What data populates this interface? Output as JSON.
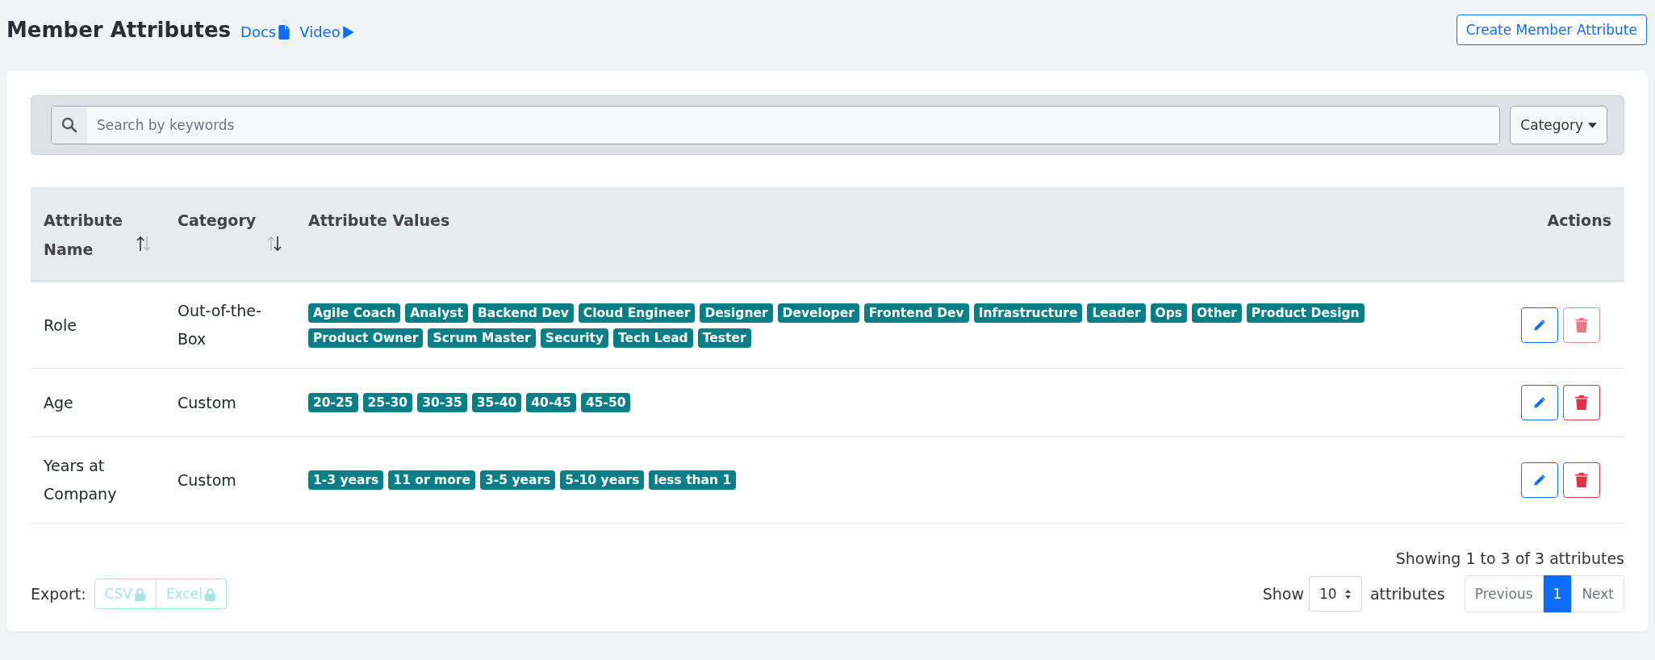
{
  "header": {
    "title": "Member Attributes",
    "links": [
      {
        "label": "Docs",
        "kind": "doc"
      },
      {
        "label": "Video",
        "kind": "video"
      }
    ],
    "create_button": "Create Member Attribute"
  },
  "filter": {
    "search": {
      "placeholder": "Search by keywords"
    },
    "category_dropdown": "Category"
  },
  "table": {
    "columns": [
      {
        "label": "Attribute Name",
        "sortable": true,
        "ascending": true
      },
      {
        "label": "Category",
        "sortable": true,
        "ascending": false
      },
      {
        "label": "Attribute Values",
        "sortable": false
      },
      {
        "label": "Actions",
        "sortable": false
      }
    ],
    "rows": [
      {
        "name": "Role",
        "category": "Out-of-the-Box",
        "values": [
          "Agile Coach",
          "Analyst",
          "Backend Dev",
          "Cloud Engineer",
          "Designer",
          "Developer",
          "Frontend Dev",
          "Infrastructure",
          "Leader",
          "Ops",
          "Other",
          "Product Design",
          "Product Owner",
          "Scrum Master",
          "Security",
          "Tech Lead",
          "Tester"
        ],
        "delete_disabled": true
      },
      {
        "name": "Age",
        "category": "Custom",
        "values": [
          "20-25",
          "25-30",
          "30-35",
          "35-40",
          "40-45",
          "45-50"
        ],
        "delete_disabled": false
      },
      {
        "name": "Years at Company",
        "category": "Custom",
        "values": [
          "1-3 years",
          "11 or more",
          "3-5 years",
          "5-10 years",
          "less than 1"
        ],
        "delete_disabled": false
      }
    ]
  },
  "export": {
    "label": "Export:",
    "buttons": [
      {
        "label": "CSV",
        "locked": true
      },
      {
        "label": "Excel",
        "locked": true
      }
    ]
  },
  "summary": "Showing 1 to 3 of 3 attributes",
  "page_size": {
    "label": "Show",
    "value": "10",
    "suffix": "attributes"
  },
  "pagination": [
    {
      "label": "Previous",
      "kind": "prev",
      "selected": false
    },
    {
      "label": "1",
      "kind": "page",
      "selected": true
    },
    {
      "label": "Next",
      "kind": "next",
      "selected": false
    }
  ]
}
